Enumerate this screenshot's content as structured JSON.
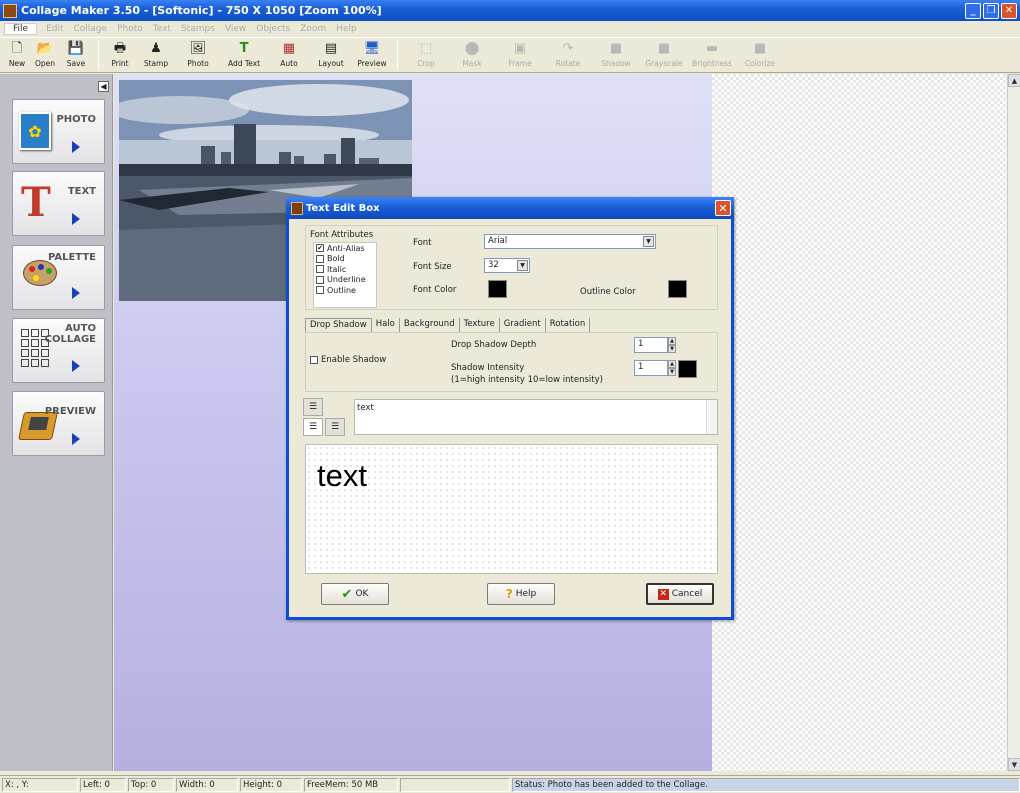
{
  "window": {
    "title": "Collage Maker 3.50 - [Softonic] - 750 X 1050 [Zoom 100%]"
  },
  "menu": [
    "File",
    "Edit",
    "Collage",
    "Photo",
    "Text",
    "Stamps",
    "View",
    "Objects",
    "Zoom",
    "Help"
  ],
  "toolbar": {
    "enabled": [
      {
        "label": "New",
        "icon": "new-doc-icon",
        "glyph": "🗋"
      },
      {
        "label": "Open",
        "icon": "folder-open-icon",
        "glyph": "📂"
      },
      {
        "label": "Save",
        "icon": "floppy-save-icon",
        "glyph": "💾"
      },
      {
        "label": "Print",
        "icon": "printer-icon",
        "glyph": "🖶"
      },
      {
        "label": "Stamp",
        "icon": "stamp-icon",
        "glyph": "♟"
      },
      {
        "label": "Photo",
        "icon": "photo-icon",
        "glyph": "🖼"
      },
      {
        "label": "Add Text",
        "icon": "add-text-icon",
        "glyph": "T"
      },
      {
        "label": "Auto",
        "icon": "auto-grid-icon",
        "glyph": "▦"
      },
      {
        "label": "Layout",
        "icon": "layout-icon",
        "glyph": "▤"
      },
      {
        "label": "Preview",
        "icon": "preview-monitor-icon",
        "glyph": "🖥"
      }
    ],
    "disabled": [
      {
        "label": "Crop",
        "icon": "crop-icon",
        "glyph": "⬚"
      },
      {
        "label": "Mask",
        "icon": "mask-icon",
        "glyph": "⬤"
      },
      {
        "label": "Frame",
        "icon": "frame-icon",
        "glyph": "▣"
      },
      {
        "label": "Rotate",
        "icon": "rotate-icon",
        "glyph": "↷"
      },
      {
        "label": "Shadow",
        "icon": "shadow-icon",
        "glyph": "■"
      },
      {
        "label": "Grayscale",
        "icon": "grayscale-icon",
        "glyph": "■"
      },
      {
        "label": "Brightness",
        "icon": "brightness-icon",
        "glyph": "▬"
      },
      {
        "label": "Colorize",
        "icon": "colorize-icon",
        "glyph": "■"
      }
    ]
  },
  "sidebar": {
    "buttons": [
      {
        "label": "PHOTO",
        "icon": "photo-side-icon",
        "glyph": "🖼",
        "color": "#2a7fc9"
      },
      {
        "label": "TEXT",
        "icon": "text-side-icon",
        "glyph": "T",
        "color": "#c23a2b"
      },
      {
        "label": "PALETTE",
        "icon": "palette-side-icon",
        "glyph": "🎨",
        "color": "#8a5a2a"
      },
      {
        "label": "AUTO\nCOLLAGE",
        "icon": "auto-collage-side-icon",
        "glyph": "▦",
        "color": "#555555"
      },
      {
        "label": "PREVIEW",
        "icon": "preview-side-icon",
        "glyph": "🖥",
        "color": "#c88a20"
      }
    ]
  },
  "dialog": {
    "title": "Text Edit Box",
    "font_attributes": {
      "title": "Font Attributes",
      "options": [
        {
          "label": "Anti-Alias",
          "checked": true
        },
        {
          "label": "Bold",
          "checked": false
        },
        {
          "label": "Italic",
          "checked": false
        },
        {
          "label": "Underline",
          "checked": false
        },
        {
          "label": "Outline",
          "checked": false
        }
      ]
    },
    "font_label": "Font",
    "font_value": "Arial",
    "font_size_label": "Font Size",
    "font_size_value": "32",
    "font_color_label": "Font Color",
    "outline_color_label": "Outline Color",
    "font_color": "#000000",
    "outline_color": "#000000",
    "tabs": [
      "Drop Shadow",
      "Halo",
      "Background",
      "Texture",
      "Gradient",
      "Rotation"
    ],
    "shadow": {
      "enable_label": "Enable Shadow",
      "enabled": false,
      "depth_label": "Drop Shadow Depth",
      "depth_value": "1",
      "intensity_label": "Shadow Intensity",
      "intensity_hint": "(1=high intensity 10=low intensity)",
      "intensity_value": "1",
      "color": "#000000"
    },
    "text_value": "text",
    "preview_text": "text",
    "buttons": {
      "ok": "OK",
      "help": "Help",
      "cancel": "Cancel"
    }
  },
  "statusbar": {
    "coords": "X: , Y:",
    "left": "Left: 0",
    "top": "Top: 0",
    "width": "Width: 0",
    "height": "Height: 0",
    "freemem": "FreeMem: 50 MB",
    "status": "Status: Photo has been added to the Collage."
  }
}
